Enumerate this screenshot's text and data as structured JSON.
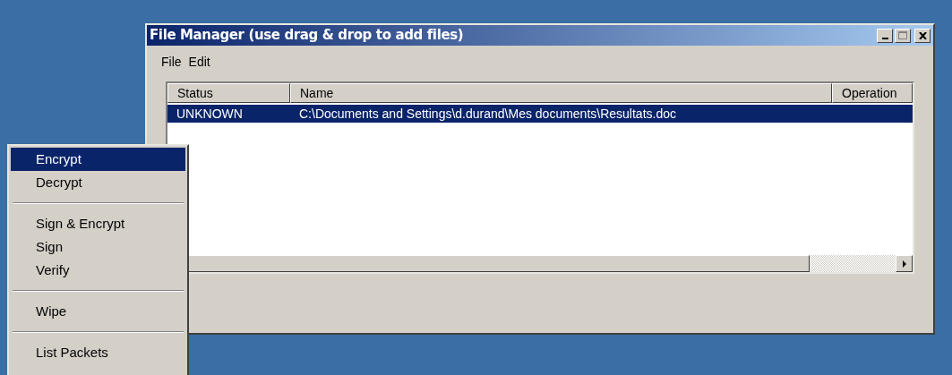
{
  "window": {
    "title": "File Manager (use drag & drop to add files)"
  },
  "menu_bar": [
    "File",
    "Edit"
  ],
  "table": {
    "columns": [
      "Status",
      "Name",
      "Operation"
    ],
    "rows": [
      {
        "cells": [
          "UNKNOWN",
          "C:\\Documents and Settings\\d.durand\\Mes documents\\Resultats.doc",
          ""
        ],
        "selected": true
      }
    ]
  },
  "context_menu": [
    {
      "kind": "item",
      "label": "Encrypt",
      "selected": true
    },
    {
      "kind": "item",
      "label": "Decrypt",
      "selected": false
    },
    {
      "kind": "separator"
    },
    {
      "kind": "item",
      "label": "Sign & Encrypt",
      "selected": false
    },
    {
      "kind": "item",
      "label": "Sign",
      "selected": false
    },
    {
      "kind": "item",
      "label": "Verify",
      "selected": false
    },
    {
      "kind": "separator"
    },
    {
      "kind": "item",
      "label": "Wipe",
      "selected": false
    },
    {
      "kind": "separator"
    },
    {
      "kind": "item",
      "label": "List Packets",
      "selected": false
    }
  ]
}
